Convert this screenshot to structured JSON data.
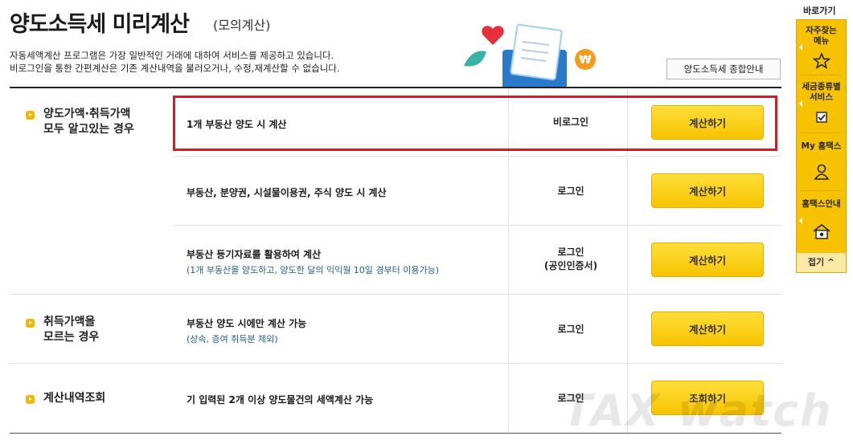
{
  "header": {
    "title": "양도소득세 미리계산",
    "subtitle": "(모의계산)",
    "desc_line1": "자동세액계산 프로그램은 가장 일반적인 거래에 대하여 서비스를 제공하고 있습니다.",
    "desc_line2": "비로그인을 통한 간편계산은 기존 계산내역을 불러오거나, 수정,재계산할 수 없습니다.",
    "guide_button": "양도소득세 종합안내"
  },
  "rows": [
    {
      "category": "양도가액·취득가액\n모두 알고있는 경우",
      "title": "1개 부동산 양도 시 계산",
      "note": "",
      "auth": "비로그인",
      "button": "계산하기"
    },
    {
      "category": "",
      "title": "부동산, 분양권, 시설물이용권, 주식 양도 시 계산",
      "note": "",
      "auth": "로그인",
      "button": "계산하기"
    },
    {
      "category": "",
      "title": "부동산 등기자료를 활용하여 계산",
      "note": "(1개 부동산을 양도하고, 양도한 달의 익익월 10일 경부터 이용가능)",
      "auth": "로그인\n(공인인증서)",
      "button": "계산하기"
    },
    {
      "category": "취득가액을\n모르는 경우",
      "title": "부동산 양도 시에만 계산 가능",
      "note": "(상속, 증여 취득분 제외)",
      "auth": "로그인",
      "button": "계산하기"
    },
    {
      "category": "계산내역조회",
      "title": "기 입력된 2개 이상 양도물건의 세액계산 가능",
      "note": "",
      "auth": "로그인",
      "button": "조회하기"
    }
  ],
  "quick_menu": {
    "heading": "바로가기",
    "items": [
      {
        "label": "자주찾는\n메뉴",
        "icon": "star-icon"
      },
      {
        "label": "세금종류별\n서비스",
        "icon": "checkbox-icon"
      },
      {
        "label": "My 홈택스",
        "icon": "user-icon"
      },
      {
        "label": "홈택스안내",
        "icon": "home-guide-icon"
      }
    ],
    "fold": "접기 ^"
  },
  "watermark": "TAX watch",
  "colors": {
    "accent": "#f7c300",
    "highlight": "#d41c26",
    "note_text": "#1f5f84"
  }
}
